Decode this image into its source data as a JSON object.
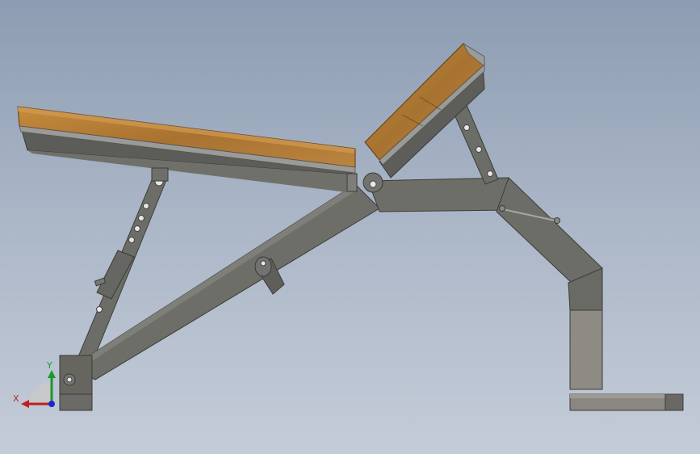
{
  "viewport": {
    "background_top": "#8d9cb2",
    "background_bottom": "#c4ccd8"
  },
  "model": {
    "frame_color": "#6b6b66",
    "frame_dark": "#4a4a46",
    "wood_color": "#b07a35",
    "pad_base_color": "#8f8f88",
    "upright_light": "#8e8b84"
  },
  "triad": {
    "x_label": "X",
    "y_label": "Y",
    "x_color": "#c21e1e",
    "y_color": "#1a9a28",
    "z_color": "#1c28c8"
  }
}
